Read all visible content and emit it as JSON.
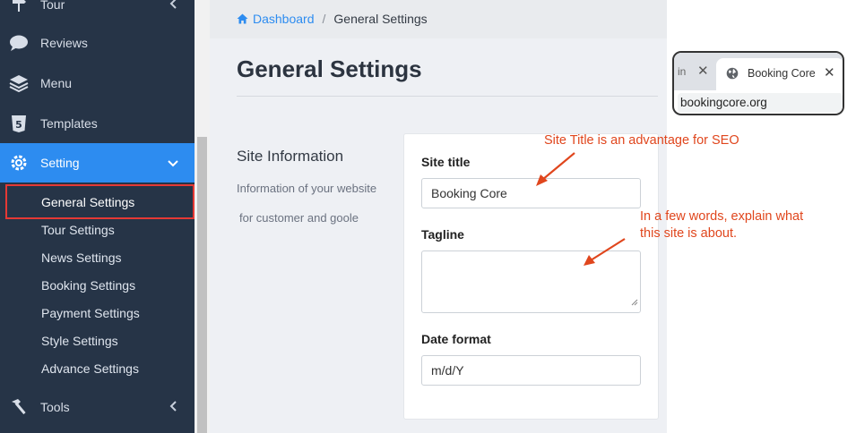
{
  "sidebar": {
    "items": [
      {
        "label": "Tour",
        "icon": "signpost-icon"
      },
      {
        "label": "Reviews",
        "icon": "comment-icon"
      },
      {
        "label": "Menu",
        "icon": "layers-icon"
      },
      {
        "label": "Templates",
        "icon": "html5-icon"
      },
      {
        "label": "Setting",
        "icon": "gear-icon",
        "active": true
      },
      {
        "label": "Tools",
        "icon": "hammer-icon"
      }
    ],
    "sub_items": [
      "General Settings",
      "Tour Settings",
      "News Settings",
      "Booking Settings",
      "Payment Settings",
      "Style Settings",
      "Advance Settings"
    ],
    "active_color": "#2d8cf0",
    "bg_color": "#263447"
  },
  "breadcrumb": {
    "home": "Dashboard",
    "separator": "/",
    "current": "General Settings"
  },
  "page": {
    "title": "General Settings"
  },
  "section": {
    "title": "Site Information",
    "desc_line1": "Information of your website",
    "desc_line2": "for customer and goole"
  },
  "form": {
    "site_title_label": "Site title",
    "site_title_value": "Booking Core",
    "tagline_label": "Tagline",
    "tagline_value": "",
    "date_format_label": "Date format",
    "date_format_value": "m/d/Y"
  },
  "annotations": {
    "site_title_note": "Site Title is an advantage for SEO",
    "tagline_note_line1": "In a few words, explain what",
    "tagline_note_line2": "this site is about.",
    "color": "#e0461d"
  },
  "browser_tab": {
    "prev_tab_text": "in",
    "title": "Booking Core",
    "url": "bookingcore.org"
  }
}
